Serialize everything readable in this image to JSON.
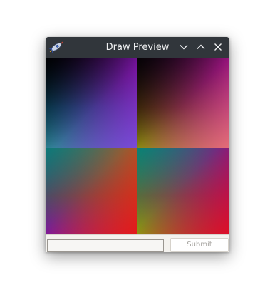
{
  "window": {
    "title": "Draw Preview",
    "app_icon": "rocket-icon"
  },
  "titlebar": {
    "buttons": [
      {
        "name": "minimize",
        "icon": "chevron-down-icon"
      },
      {
        "name": "maximize",
        "icon": "chevron-up-icon"
      },
      {
        "name": "close",
        "icon": "close-icon"
      }
    ]
  },
  "canvas": {
    "quadrants": [
      "top-left",
      "top-right",
      "bottom-left",
      "bottom-right"
    ]
  },
  "form": {
    "input_value": "",
    "submit_label": "Submit",
    "submit_enabled": false
  },
  "colors": {
    "titlebar_bg": "#31363b",
    "titlebar_text": "#eff0f1",
    "window_bg": "#f4f2ee",
    "submit_text_disabled": "#a8a6a2"
  }
}
